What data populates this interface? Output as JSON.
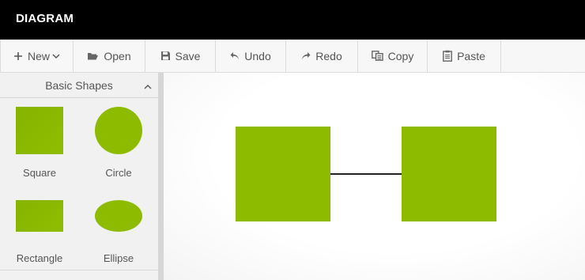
{
  "app": {
    "title": "DIAGRAM"
  },
  "toolbar": {
    "new_label": "New",
    "open_label": "Open",
    "save_label": "Save",
    "undo_label": "Undo",
    "redo_label": "Redo",
    "copy_label": "Copy",
    "paste_label": "Paste"
  },
  "sidebar": {
    "section_title": "Basic Shapes",
    "items": [
      {
        "label": "Square",
        "icon": "square-shape-icon"
      },
      {
        "label": "Circle",
        "icon": "circle-shape-icon"
      },
      {
        "label": "Rectangle",
        "icon": "rectangle-shape-icon"
      },
      {
        "label": "Ellipse",
        "icon": "ellipse-shape-icon"
      }
    ]
  },
  "canvas": {
    "nodes": [
      {
        "shape": "square",
        "color": "#8dbb00"
      },
      {
        "shape": "square",
        "color": "#8dbb00"
      }
    ],
    "connections": [
      {
        "from": 0,
        "to": 1,
        "color": "#222222"
      }
    ]
  },
  "colors": {
    "accent": "#8dbb00",
    "titlebar": "#000000",
    "toolbar": "#f7f7f7",
    "sidebar": "#f1f1f1"
  }
}
